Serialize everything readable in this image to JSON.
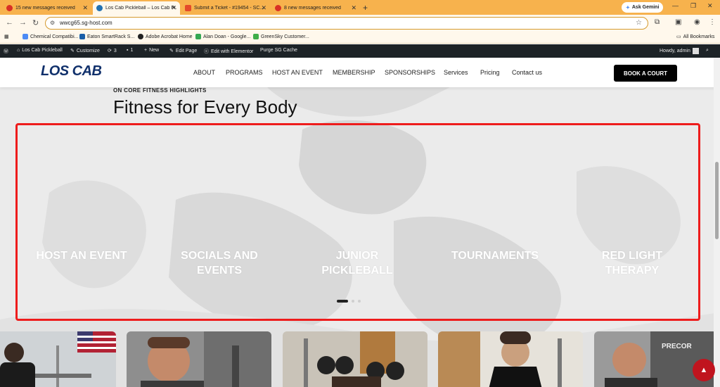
{
  "browser": {
    "tabs": [
      {
        "title": "15 new messages received",
        "favicon_color": "#d93025"
      },
      {
        "title": "Los Cab Pickleball – Los Cab Pi...",
        "favicon_color": "#2271b1"
      },
      {
        "title": "Submit a Ticket - #19454 - SC...",
        "favicon_color": "#e44a2a"
      },
      {
        "title": "8 new messages received",
        "favicon_color": "#d93025"
      }
    ],
    "new_tab_label": "+",
    "gemini_label": "Ask Gemini",
    "url": "wwcg65.sg-host.com",
    "bookmarks": [
      {
        "label": "Chemical Compatibi...",
        "color": "#4c8bf5"
      },
      {
        "label": "Eaton SmartRack S...",
        "color": "#1a5fa8"
      },
      {
        "label": "Adobe Acrobat Home",
        "color": "#222222"
      },
      {
        "label": "Alan Doan - Google...",
        "color": "#34a853"
      },
      {
        "label": "GreenSky Customer...",
        "color": "#3fae49"
      }
    ],
    "all_bookmarks_label": "All Bookmarks"
  },
  "adminbar": {
    "site_name": "Los Cab Pickleball",
    "customize": "Customize",
    "updates": "3",
    "comments": "1",
    "new": "New",
    "edit_page": "Edit Page",
    "elementor": "Edit with Elementor",
    "purge": "Purge SG Cache",
    "howdy": "Howdy, admin"
  },
  "site": {
    "logo": "LOS CAB",
    "nav": [
      "ABOUT",
      "PROGRAMS",
      "HOST AN EVENT",
      "MEMBERSHIP",
      "SPONSORSHIPS",
      "Services",
      "Pricing",
      "Contact us"
    ],
    "cta": "BOOK A COURT"
  },
  "section": {
    "kicker": "ON CORE FITNESS HIGHLIGHTS",
    "title": "Fitness for Every Body",
    "slides": [
      {
        "line1": "",
        "line2": "HOST AN EVENT"
      },
      {
        "line1": "SOCIALS AND",
        "line2": "EVENTS"
      },
      {
        "line1": "JUNIOR",
        "line2": "PICKLEBALL"
      },
      {
        "line1": "",
        "line2": "TOURNAMENTS"
      },
      {
        "line1": "RED LIGHT",
        "line2": "THERAPY"
      }
    ],
    "carousel_dots": 3,
    "active_dot": 0
  },
  "colors": {
    "brand_navy": "#10306b",
    "highlight_red": "#ee1c1c",
    "tab_strip": "#f7b24d"
  }
}
